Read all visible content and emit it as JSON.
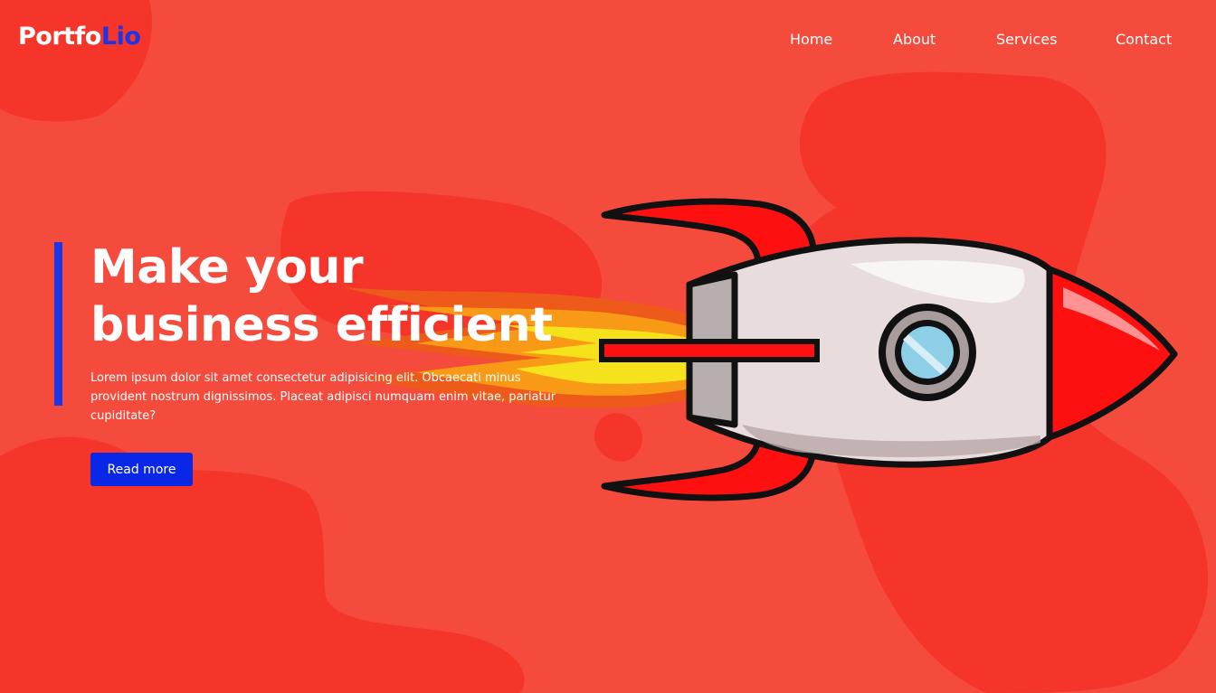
{
  "header": {
    "logo_part_a": "Portfo",
    "logo_part_b": "Lio",
    "nav": [
      "Home",
      "About",
      "Services",
      "Contact"
    ]
  },
  "hero": {
    "title_line1": "Make your",
    "title_line2": "business efficient",
    "text": "Lorem ipsum dolor sit amet consectetur adipisicing elit. Obcaecati minus provident nostrum dignissimos. Placeat adipisci numquam enim vitae, pariatur cupiditate?",
    "button_label": "Read more"
  },
  "colors": {
    "background": "#f44b3d",
    "blob": "#f5342a",
    "accent_blue": "#1e35e6",
    "button": "#0a27e8"
  },
  "illustration": "rocket-icon"
}
